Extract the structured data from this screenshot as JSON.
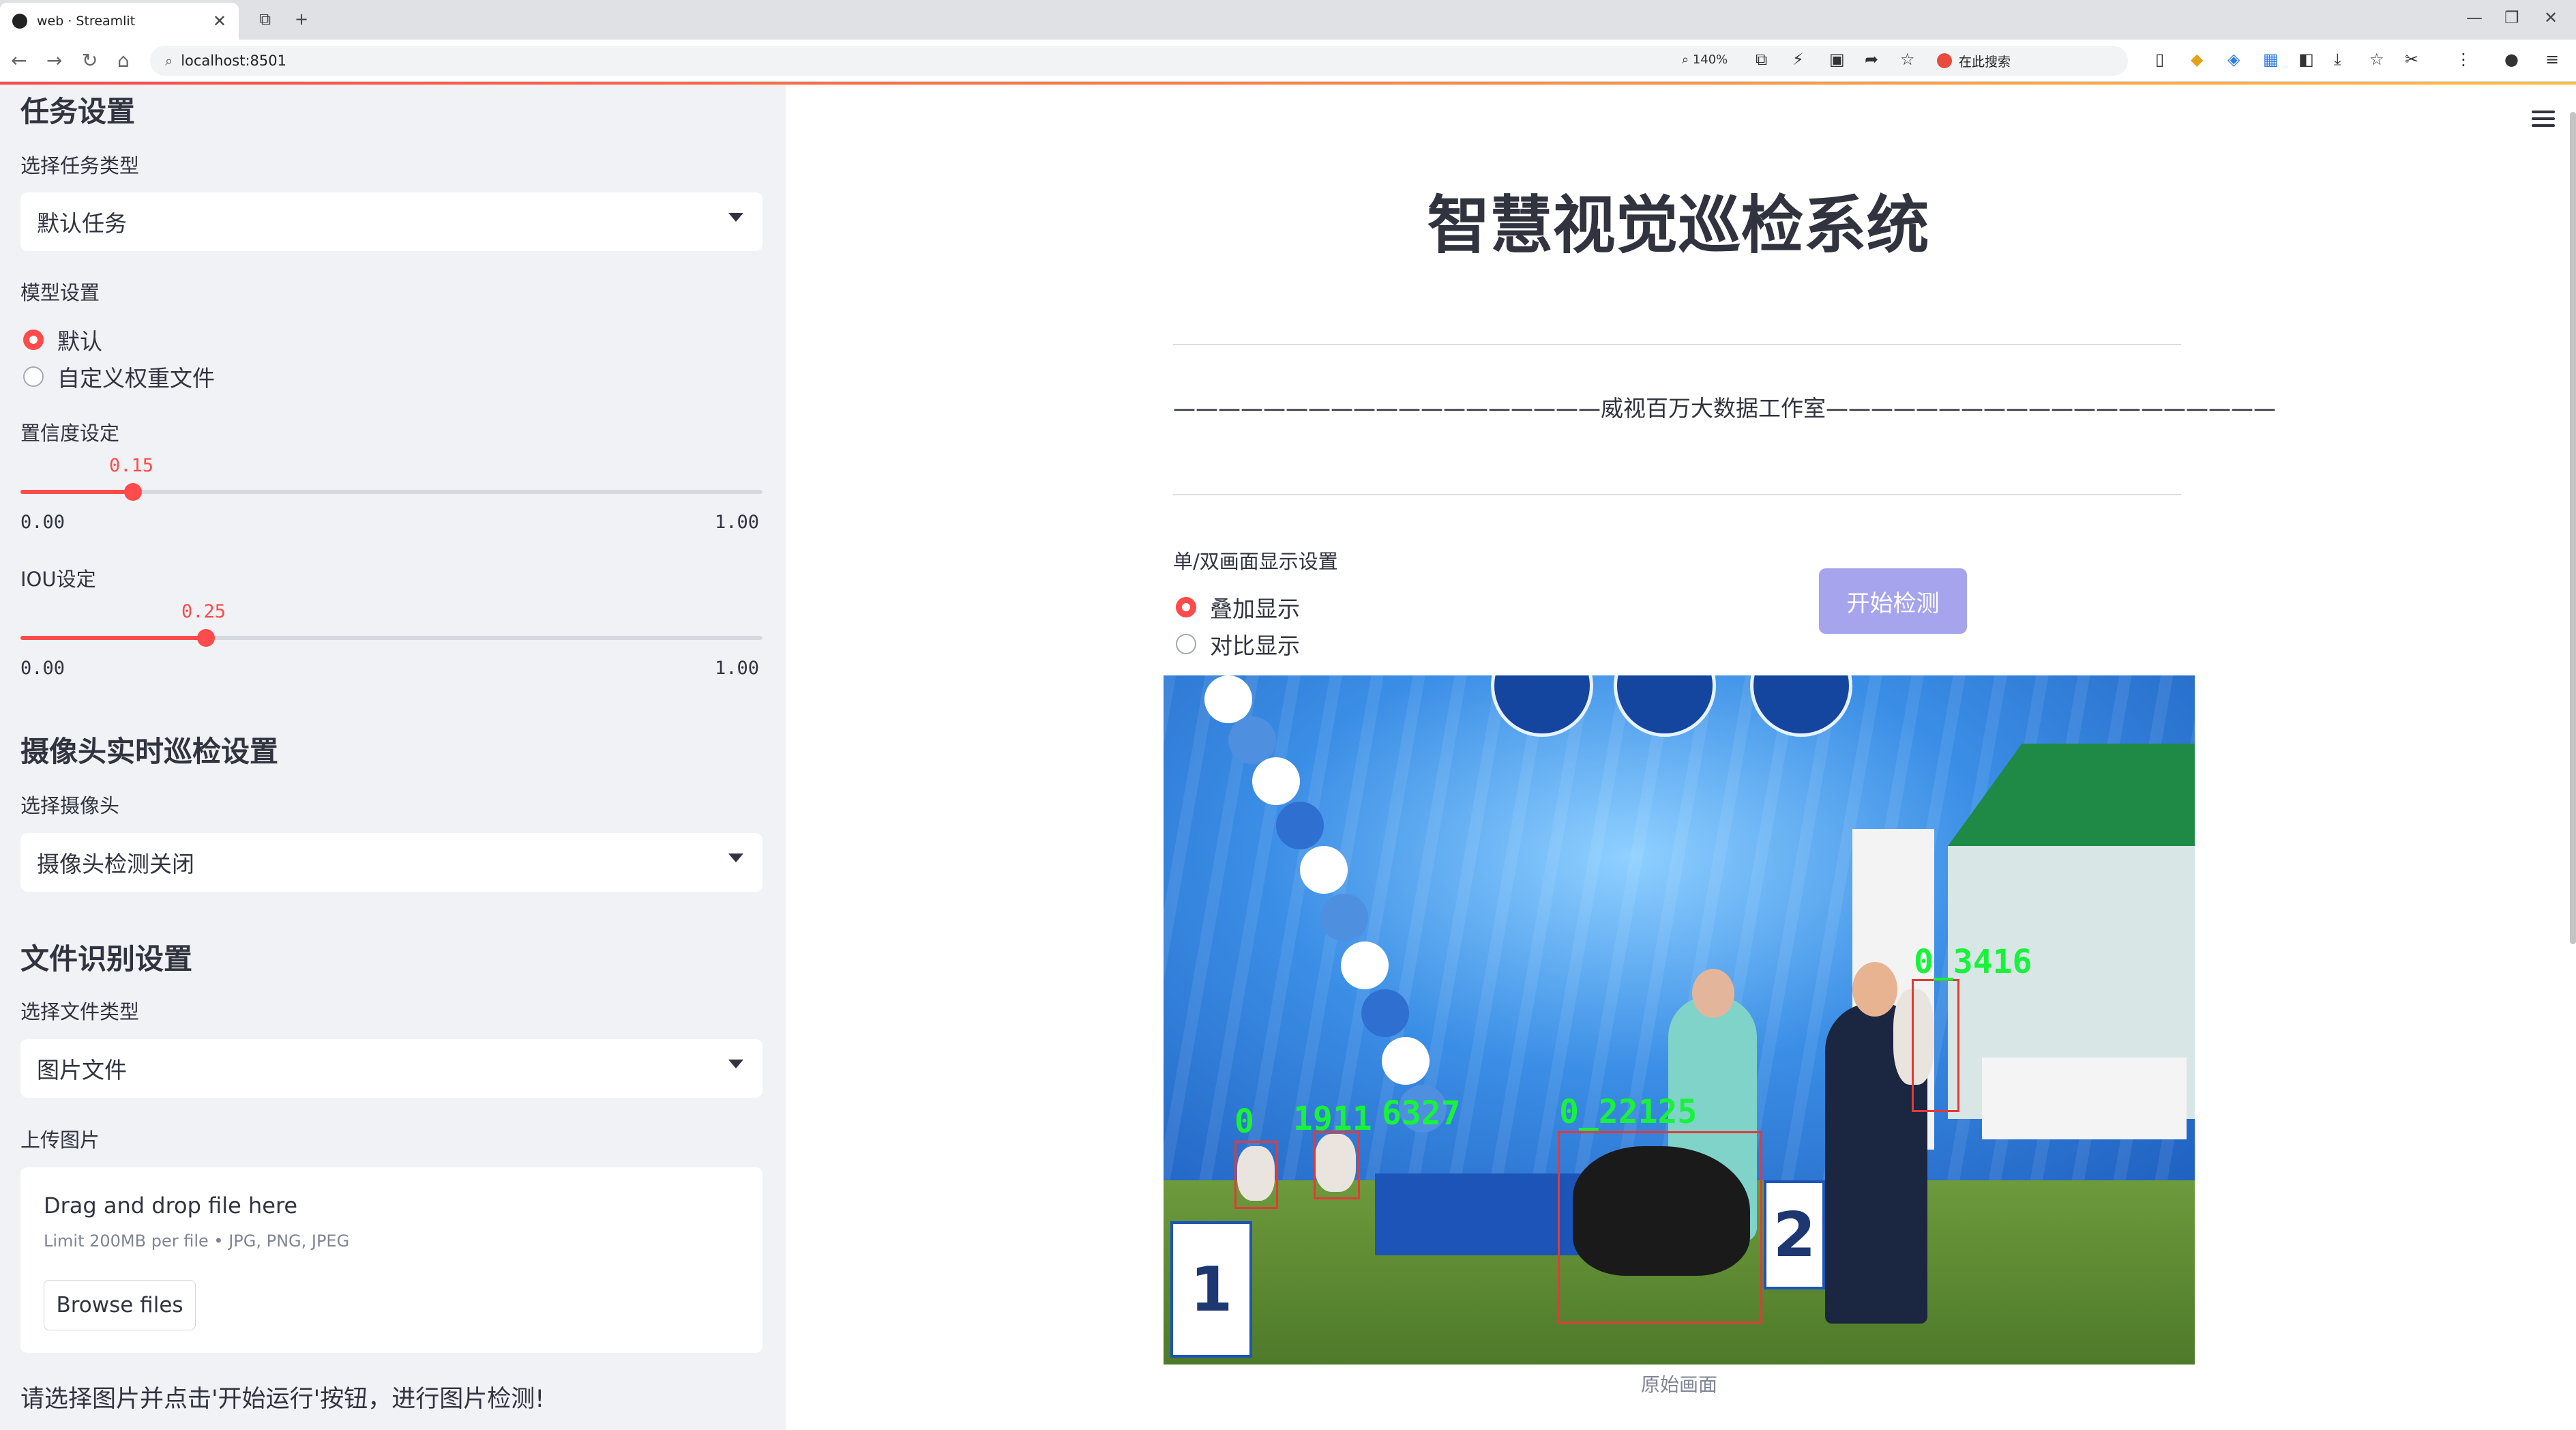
{
  "browser": {
    "tab_title": "web · Streamlit",
    "url": "localhost:8501",
    "zoom": "140%",
    "search_engine_label": "在此搜索"
  },
  "sidebar": {
    "task_heading": "任务设置",
    "task_type_label": "选择任务类型",
    "task_type_value": "默认任务",
    "model_label": "模型设置",
    "model_options": [
      "默认",
      "自定义权重文件"
    ],
    "model_selected": 0,
    "conf_label": "置信度设定",
    "conf_value": "0.15",
    "conf_min": "0.00",
    "conf_max": "1.00",
    "iou_label": "IOU设定",
    "iou_value": "0.25",
    "iou_min": "0.00",
    "iou_max": "1.00",
    "camera_heading": "摄像头实时巡检设置",
    "camera_label": "选择摄像头",
    "camera_value": "摄像头检测关闭",
    "file_heading": "文件识别设置",
    "file_type_label": "选择文件类型",
    "file_type_value": "图片文件",
    "upload_label": "上传图片",
    "upload_title": "Drag and drop file here",
    "upload_limit": "Limit 200MB per file • JPG, PNG, JPEG",
    "browse_label": "Browse files",
    "note": "请选择图片并点击'开始运行'按钮，进行图片检测!"
  },
  "main": {
    "title": "智慧视觉巡检系统",
    "subtitle": "———————————————————威视百万大数据工作室————————————————————",
    "display_label": "单/双画面显示设置",
    "display_options": [
      "叠加显示",
      "对比显示"
    ],
    "display_selected": 0,
    "start_button": "开始检测",
    "image_caption": "原始画面",
    "detections": [
      {
        "label": "0_3416"
      },
      {
        "label": "0_22125"
      },
      {
        "label": "0"
      },
      {
        "label": "1911"
      },
      {
        "label": "6327"
      }
    ]
  },
  "colors": {
    "accent": "#ff4b4b",
    "button": "#a5a4ec",
    "sidebar_bg": "#f0f2f6",
    "box": "#e23a3a",
    "box_label": "#19f23a"
  }
}
